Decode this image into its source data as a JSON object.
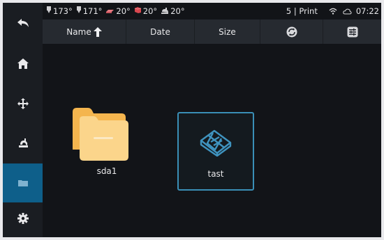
{
  "colors": {
    "accent": "#0e5f8a",
    "selection_border": "#3a8fb7",
    "folder": "#f5c262"
  },
  "status_bar": {
    "temps": [
      {
        "icon": "nozzle-1-icon",
        "value": "173°"
      },
      {
        "icon": "nozzle-2-icon",
        "value": "171°"
      },
      {
        "icon": "heated-bed-icon",
        "value": "20°"
      },
      {
        "icon": "chamber-icon",
        "value": "20°"
      },
      {
        "icon": "fan-temp-icon",
        "value": "20°"
      }
    ],
    "print_status": "5 | Print",
    "time": "07:22"
  },
  "header": {
    "columns": [
      {
        "label": "Name",
        "icon": "sort-up-arrow-icon"
      },
      {
        "label": "Date"
      },
      {
        "label": "Size"
      },
      {
        "icon": "refresh-icon"
      },
      {
        "icon": "list-options-icon"
      }
    ]
  },
  "sidebar": {
    "items": [
      {
        "icon": "back-arrow-icon"
      },
      {
        "icon": "home-icon"
      },
      {
        "icon": "move-icon"
      },
      {
        "icon": "extruder-icon"
      },
      {
        "icon": "folder-icon",
        "active": true
      },
      {
        "icon": "settings-gear-icon"
      }
    ]
  },
  "files": [
    {
      "name": "sda1",
      "type": "folder"
    },
    {
      "name": "tast",
      "type": "gcode",
      "selected": true
    }
  ]
}
